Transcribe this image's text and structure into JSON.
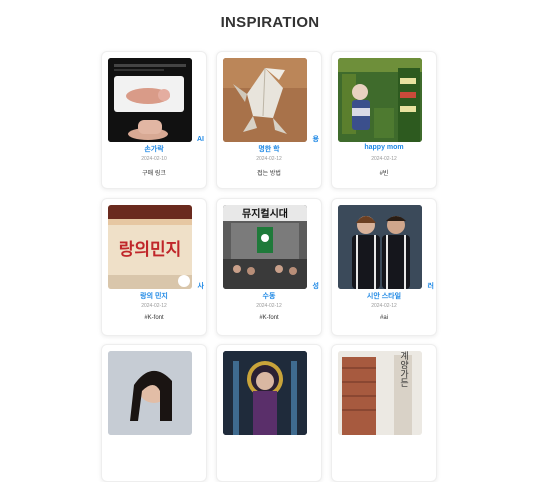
{
  "page": {
    "title": "INSPIRATION"
  },
  "cards": [
    {
      "corner": "AI",
      "name": "손가락",
      "date": "2024-02-10",
      "desc": "구매 링크"
    },
    {
      "corner": "용",
      "name": "명한 학",
      "date": "2024-02-12",
      "desc": "접는 방법"
    },
    {
      "corner": "",
      "name": "happy mom",
      "date": "2024-02-12",
      "desc": "#빈"
    },
    {
      "corner": "사",
      "name": "랑의 민지",
      "date": "2024-02-12",
      "desc": "#K-font"
    },
    {
      "corner": "성",
      "name": "수동",
      "date": "2024-02-12",
      "desc": "#K-font"
    },
    {
      "corner": "러",
      "name": "시안 스타일",
      "date": "2024-02-12",
      "desc": "#ai"
    },
    {
      "corner": "",
      "name": "",
      "date": "",
      "desc": ""
    },
    {
      "corner": "",
      "name": "",
      "date": "",
      "desc": ""
    },
    {
      "corner": "",
      "name": "",
      "date": "",
      "desc": ""
    }
  ],
  "images": {
    "sign_text": "랑의민지",
    "banner_text": "뮤지컬시대",
    "pole_text": "계양가든"
  }
}
